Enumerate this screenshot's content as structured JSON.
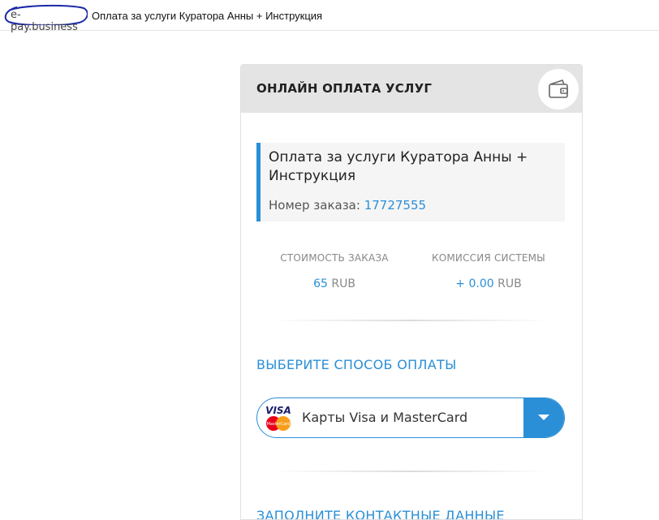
{
  "header": {
    "domain": "e-pay.business",
    "page_title": "Оплата за услуги Куратора Анны + Инструкция"
  },
  "card": {
    "title": "ОНЛАЙН ОПЛАТА УСЛУГ",
    "wallet_icon": "wallet-icon",
    "order": {
      "title": "Оплата за услуги Куратора Анны + Инструкция",
      "number_label": "Номер заказа:",
      "number_value": "17727555"
    },
    "price": {
      "cost_label": "СТОИМОСТЬ ЗАКАЗА",
      "cost_amount": "65",
      "cost_currency": "RUB",
      "fee_label": "КОМИССИЯ СИСТЕМЫ",
      "fee_amount": "+ 0.00",
      "fee_currency": "RUB"
    },
    "payment": {
      "section_title": "ВЫБЕРИТЕ СПОСОБ ОПЛАТЫ",
      "selected_method": "Карты Visa и MasterCard",
      "logo_visa_text": "VISA",
      "logo_mc_text": "MasterCard"
    },
    "contact": {
      "section_title": "ЗАПОЛНИТЕ КОНТАКТНЫЕ ДАННЫЕ"
    }
  },
  "colors": {
    "accent": "#2a8fd6",
    "header_bg": "#e4e4e4",
    "order_bg": "#f5f5f5"
  }
}
